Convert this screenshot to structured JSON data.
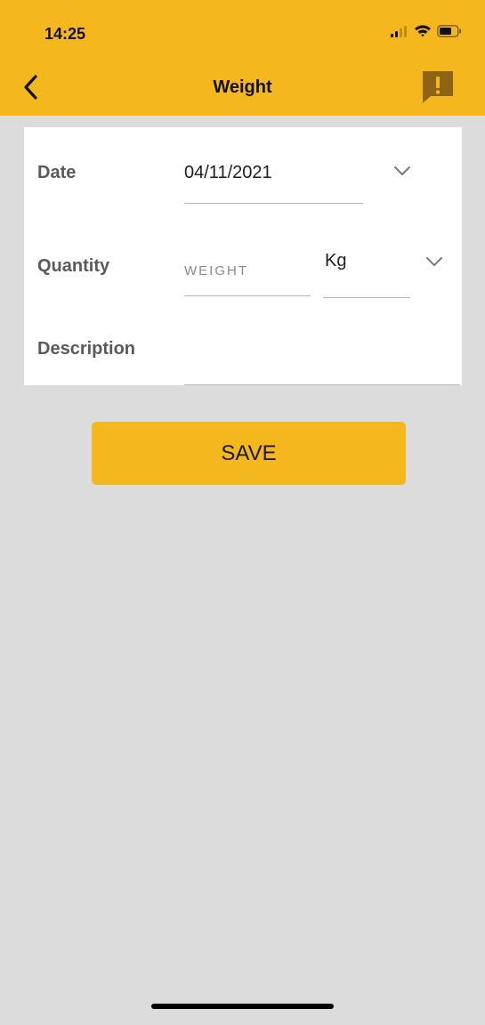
{
  "status_bar": {
    "time": "14:25"
  },
  "header": {
    "title": "Weight",
    "back_icon": "chevron-left-icon",
    "report_icon": "exclamation-bubble-icon"
  },
  "form": {
    "date": {
      "label": "Date",
      "value": "04/11/2021"
    },
    "quantity": {
      "label": "Quantity",
      "placeholder": "WEIGHT",
      "unit": "Kg"
    },
    "description": {
      "label": "Description",
      "value": ""
    }
  },
  "actions": {
    "save_label": "SAVE"
  },
  "colors": {
    "accent": "#f4b71d",
    "background": "#dcdcdc",
    "card": "#ffffff"
  }
}
